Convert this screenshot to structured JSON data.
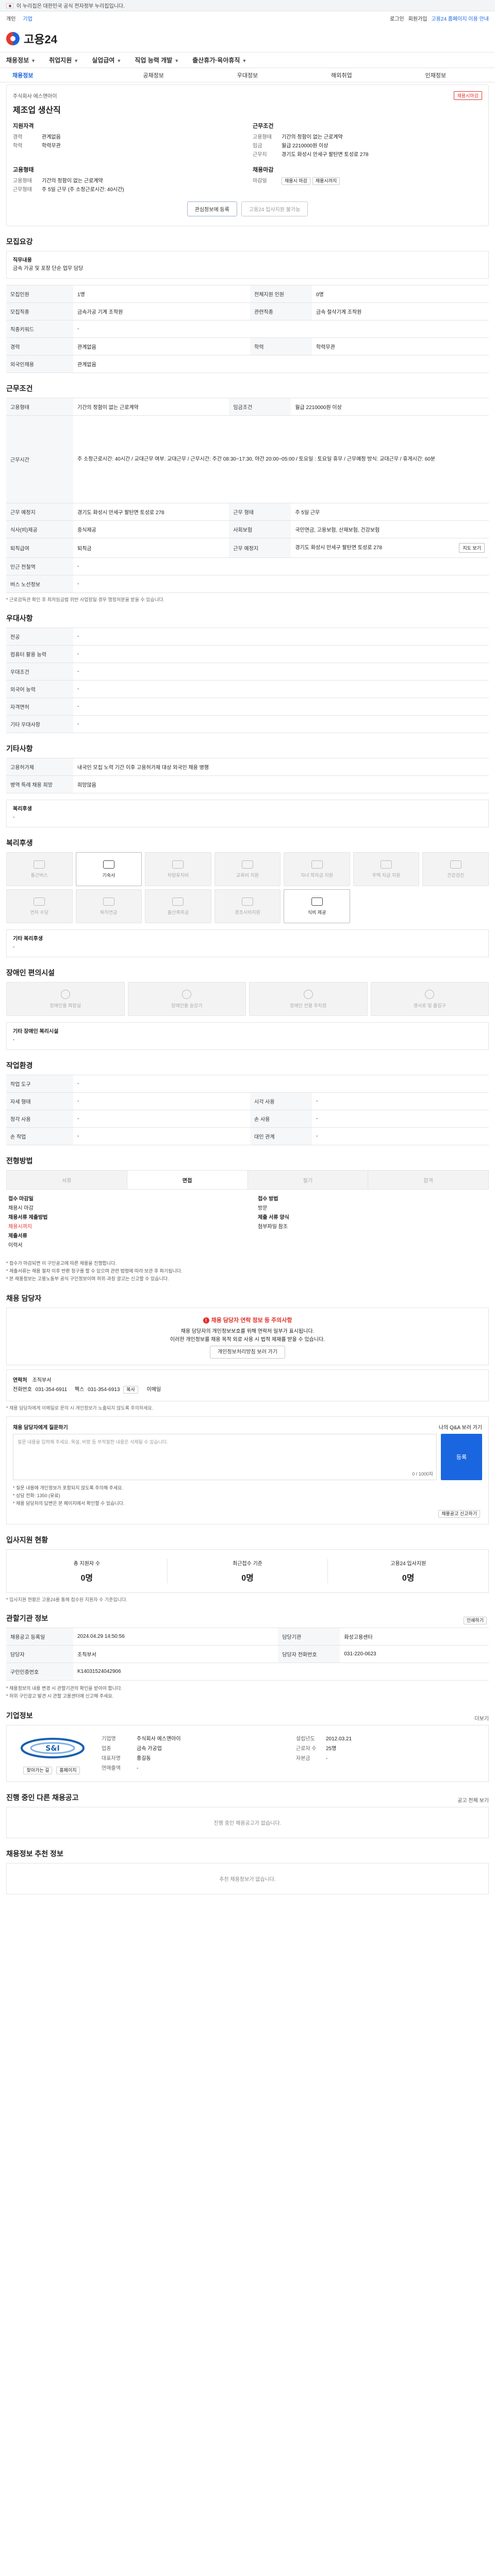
{
  "gov": {
    "text": "이 누리집은 대한민국 공식 전자정부 누리집입니다."
  },
  "util": {
    "tabs": [
      "개인",
      "기업"
    ],
    "links": [
      "로그인",
      "회원가입",
      "고용24 홈페이지 이용 안내"
    ]
  },
  "header": {
    "logo": "고용24"
  },
  "gnb": {
    "items": [
      "채용정보",
      "취업지원",
      "실업급여",
      "직업 능력 개발",
      "출산휴가·육아휴직"
    ]
  },
  "subnav": {
    "items": [
      "채용정보",
      "공채정보",
      "우대정보",
      "해외취업",
      "인재정보"
    ]
  },
  "summary": {
    "corp_label": "주식회사 에스앤아이",
    "title": "제조업 생산직",
    "badge": "채용시마감",
    "left_title": "지원자격",
    "left_rows": [
      [
        "경력",
        "관계없음"
      ],
      [
        "학력",
        "학력무관"
      ]
    ],
    "right_title": "근무조건",
    "right_rows": [
      [
        "고용형태",
        "기간의 정함이 없는 근로계약"
      ],
      [
        "임금",
        "월급 2210000원 이상"
      ],
      [
        "근무지",
        "경기도 화성시 만세구 팔탄면 토성로 278"
      ]
    ],
    "left2_title": "고용형태",
    "left2_rows": [
      [
        "고용형태",
        "기간의 정함이 없는 근로계약"
      ],
      [
        "근무형태",
        "주 5일 근무 (주 소정근로시간: 40시간)"
      ]
    ],
    "right2_title": "채용마감",
    "right2_rows": [
      [
        "마감일",
        "채용시 마감"
      ]
    ],
    "pill": "채용시까지",
    "btn_scrap": "관심정보에 등록",
    "btn_apply": "고용24 입사지원 불가능"
  },
  "recruit": {
    "heading": "모집요강",
    "duty_label": "직무내용",
    "duty_text": "금속 가공 및 포장 단순 업무 담당",
    "rows": [
      [
        "모집인원",
        "1명",
        "전체지원 인원",
        "0명"
      ],
      [
        "모집직종",
        "금속가공 기계 조작원",
        "관련직종",
        "금속 절삭기계 조작원"
      ],
      [
        "직종키워드",
        "-",
        "",
        ""
      ],
      [
        "경력",
        "관계없음",
        "학력",
        "학력무관"
      ],
      [
        "외국인채용",
        "관계없음",
        "",
        ""
      ]
    ]
  },
  "work": {
    "heading": "근무조건",
    "rows": [
      [
        "고용형태",
        "기간의 정함이 없는 근로계약",
        "임금조건",
        "월급 2210000원 이상"
      ],
      [
        "근무시간",
        "주 소정근로시간: 40시간 / 교대근무 여부: 교대근무 / 근무시간: 주간 08:30~17:30, 야간 20:00~05:00 / 토요일 : 토요일 휴무 / 근무예정 방식: 교대근무 / 휴게시간: 60분",
        "",
        ""
      ],
      [
        "근무 예정지",
        "경기도 화성시 만세구 팔탄면 토성로 278",
        "근무 형태",
        "주 5일 근무"
      ],
      [
        "식사(비)제공",
        "중식제공",
        "사회보험",
        "국민연금, 고용보험, 산재보험, 건강보험"
      ],
      [
        "퇴직급여",
        "퇴직금",
        "근무 예정지",
        "경기도 화성시 만세구 팔탄면 토성로 278"
      ],
      [
        "인근 전철역",
        "-",
        "",
        ""
      ],
      [
        "버스 노선정보",
        "-",
        "",
        ""
      ]
    ],
    "note": "* 근로감독관 확인 후 최저임금법 위반 사업장일 경우 행정처분을 받을 수 있습니다.",
    "map_btn": "지도 보기"
  },
  "qual": {
    "heading": "우대사항",
    "rows": [
      [
        "전공",
        "-"
      ],
      [
        "컴퓨터 활용 능력",
        "-"
      ],
      [
        "우대조건",
        "-"
      ],
      [
        "외국어 능력",
        "-"
      ],
      [
        "자격면허",
        "-"
      ],
      [
        "기타 우대사항",
        "-"
      ]
    ]
  },
  "etc": {
    "heading": "기타사항",
    "rows": [
      [
        "고용허가제",
        "내국인 모집 노력 기간 이후 고용허가제 대상 외국인 채용 병행"
      ],
      [
        "병역 특례 채용 희망",
        "희망않음"
      ]
    ],
    "welfare_title": "복리후생",
    "welfare_text": "-"
  },
  "benefit": {
    "heading": "복리후생",
    "tiles": [
      "통근버스",
      "기숙사",
      "차량유지비",
      "교육비 지원",
      "자녀 학자금 지원",
      "주택 자금 지원",
      "건강검진",
      "연차 수당",
      "퇴직연금",
      "출산축하금",
      "경조사비지원",
      "식비 제공"
    ],
    "on": [
      1,
      11
    ],
    "other_label": "기타 복리후생",
    "other_val": "-"
  },
  "disabled": {
    "heading": "장애인 편의시설",
    "tiles": [
      "장애인용 화장실",
      "장애인용 승강기",
      "장애인 전용 주차장",
      "경사로 및 출입구"
    ],
    "other_label": "기타 장애인 복리시설",
    "other_val": "-"
  },
  "env": {
    "heading": "작업환경",
    "rows": [
      [
        "작업 도구",
        "-",
        "",
        ""
      ],
      [
        "자세 형태",
        "-",
        "시각 사용",
        "-"
      ],
      [
        "청각 사용",
        "-",
        "손 사용",
        "-"
      ],
      [
        "손 작업",
        "-",
        "대인 관계",
        "-"
      ]
    ]
  },
  "process": {
    "heading": "전형방법",
    "steps": [
      "서류",
      "면접",
      "필기",
      "합격"
    ],
    "on": 1,
    "left": [
      [
        "접수 마감일",
        "채용시 마감"
      ],
      [
        "채용서류 제출방법",
        "채용시까지"
      ],
      [
        "제출서류",
        "이력서"
      ]
    ],
    "right": [
      [
        "접수 방법",
        "방문"
      ],
      [
        "제출 서류 양식",
        "첨부파일 참조"
      ]
    ],
    "notes": [
      "* 접수가 마감되면 이 구인공고에 따른 채용을 진행합니다.",
      "* 제출서류는 채용 절차 이후 반환 청구를 할 수 있으며 관련 법령에 따라 보관 후 파기됩니다.",
      "* 본 채용정보는 고용노동부 공식 구인정보이며 허위·과장 광고는 신고할 수 있습니다."
    ]
  },
  "contact": {
    "heading": "채용 담당자",
    "alert_title": "채용 담당자 연락 정보 등 주의사항",
    "alert_lines": [
      "채용 담당자의 개인정보보호를 위해 연락처 일부가 표시됩니다.",
      "이러한 개인정보를 채용 목적 외로 사용 시 법적 제재를 받을 수 있습니다."
    ],
    "alert_btn": "개인정보처리방침 보러 가기",
    "name_label": "연락처",
    "name_val": "조직부서",
    "phone_label": "전화번호",
    "phone_val": "031-354-6911",
    "fax_label": "팩스",
    "fax_val": "031-354-6913",
    "email_label": "이메일",
    "copy_btn": "복사",
    "note": "* 채용 담당자에게 이메일로 문의 시 개인정보가 노출되지 않도록 주의하세요."
  },
  "question": {
    "heading": "채용 담당자에게 질문하기",
    "link": "나의 Q&A 보러 가기",
    "placeholder": "질문 내용을 입력해 주세요. 욕설, 비방 등 부적절한 내용은 삭제될 수 있습니다.",
    "count": "0 / 1000자",
    "btn": "등록",
    "notes": [
      "* 질문 내용에 개인정보가 포함되지 않도록 주의해 주세요.",
      "* 상담 전화: 1350 (유료)",
      "* 채용 담당자의 답변은 본 페이지에서 확인할 수 있습니다."
    ],
    "report_btn": "채용공고 신고하기"
  },
  "apply": {
    "heading": "입사지원 현황",
    "items": [
      [
        "총 지원자 수",
        "0명"
      ],
      [
        "최근접수 기준",
        "0명"
      ],
      [
        "고용24 입사지원",
        "0명"
      ]
    ],
    "note": "* 입사지원 현황은 고용24를 통해 접수된 지원자 수 기준입니다."
  },
  "agency": {
    "heading": "관할기관 정보",
    "btn": "인쇄하기",
    "rows": [
      [
        "채용공고 등록일",
        "2024.04.29 14:50:56",
        "담당기관",
        "화성고용센터"
      ],
      [
        "담당자",
        "조직부서",
        "담당자 전화번호",
        "031-220-0623"
      ],
      [
        "구인인증번호",
        "K14031524042906"
      ]
    ],
    "notes": [
      "* 채용정보의 내용 변경 시 관할기관의 확인을 받아야 합니다.",
      "* 허위 구인광고 발견 시 관할 고용센터에 신고해 주세요."
    ]
  },
  "company": {
    "heading": "기업정보",
    "more": "더보기",
    "logo_text": "S&I",
    "rows": [
      [
        "기업명",
        "주식회사 에스앤아이",
        "설립년도",
        "2012.03.21"
      ],
      [
        "업종",
        "금속 가공업",
        "근로자 수",
        "25명"
      ],
      [
        "대표자명",
        "홍길동",
        "자본금",
        "-"
      ],
      [
        "연매출액",
        "-",
        "",
        ""
      ]
    ],
    "btn_map": "찾아가는 길",
    "btn_home": "홈페이지"
  },
  "other_jobs": {
    "heading": "진행 중인 다른 채용공고",
    "more": "공고 전체 보기",
    "empty": "진행 중인 채용공고가 없습니다."
  },
  "recommend": {
    "heading": "채용정보 추천 정보",
    "empty": "추천 채용정보가 없습니다."
  }
}
